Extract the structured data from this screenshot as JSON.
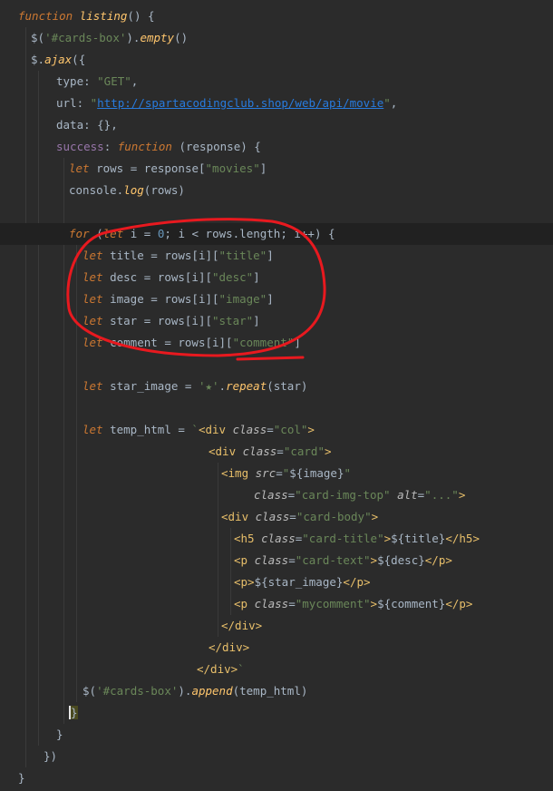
{
  "editor": {
    "lines": [
      [
        [
          "kw",
          "function "
        ],
        [
          "fn",
          "listing"
        ],
        [
          "id",
          "() {"
        ]
      ],
      [
        [
          "id",
          "$("
        ],
        [
          "str",
          "'#cards-box'"
        ],
        [
          "id",
          ")."
        ],
        [
          "fn",
          "empty"
        ],
        [
          "id",
          "()"
        ]
      ],
      [
        [
          "id",
          "$."
        ],
        [
          "fn",
          "ajax"
        ],
        [
          "id",
          "({"
        ]
      ],
      [
        [
          "id",
          "type: "
        ],
        [
          "str",
          "\"GET\""
        ],
        [
          "id",
          ","
        ]
      ],
      [
        [
          "id",
          "url: "
        ],
        [
          "str",
          "\""
        ],
        [
          "url",
          "http://spartacodingclub.shop/web/api/movie"
        ],
        [
          "str",
          "\""
        ],
        [
          "id",
          ","
        ]
      ],
      [
        [
          "id",
          "data: {},"
        ]
      ],
      [
        [
          "prop",
          "success"
        ],
        [
          "id",
          ": "
        ],
        [
          "kw",
          "function "
        ],
        [
          "id",
          "(response) {"
        ]
      ],
      [
        [
          "kw",
          "let "
        ],
        [
          "id",
          "rows = response["
        ],
        [
          "str",
          "\"movies\""
        ],
        [
          "id",
          "]"
        ]
      ],
      [
        [
          "id",
          "console."
        ],
        [
          "fn",
          "log"
        ],
        [
          "id",
          "(rows)"
        ]
      ],
      [
        [
          "id",
          ""
        ]
      ],
      [
        [
          "kw",
          "for "
        ],
        [
          "id",
          "("
        ],
        [
          "kw",
          "let "
        ],
        [
          "id",
          "i = "
        ],
        [
          "num",
          "0"
        ],
        [
          "id",
          "; i < rows.length; i++) {"
        ]
      ],
      [
        [
          "kw",
          "let "
        ],
        [
          "id",
          "title = rows[i]["
        ],
        [
          "str",
          "\"title\""
        ],
        [
          "id",
          "]"
        ]
      ],
      [
        [
          "kw",
          "let "
        ],
        [
          "id",
          "desc = rows[i]["
        ],
        [
          "str",
          "\"desc\""
        ],
        [
          "id",
          "]"
        ]
      ],
      [
        [
          "kw",
          "let "
        ],
        [
          "id",
          "image = rows[i]["
        ],
        [
          "str",
          "\"image\""
        ],
        [
          "id",
          "]"
        ]
      ],
      [
        [
          "kw",
          "let "
        ],
        [
          "id",
          "star = rows[i]["
        ],
        [
          "str",
          "\"star\""
        ],
        [
          "id",
          "]"
        ]
      ],
      [
        [
          "kw",
          "let "
        ],
        [
          "id",
          "comment = rows[i]["
        ],
        [
          "str",
          "\"comment\""
        ],
        [
          "id",
          "]"
        ]
      ],
      [
        [
          "id",
          ""
        ]
      ],
      [
        [
          "kw",
          "let "
        ],
        [
          "id",
          "star_image = "
        ],
        [
          "str",
          "'★'"
        ],
        [
          "id",
          "."
        ],
        [
          "fn",
          "repeat"
        ],
        [
          "id",
          "(star)"
        ]
      ],
      [
        [
          "id",
          ""
        ]
      ],
      [
        [
          "kw",
          "let "
        ],
        [
          "id",
          "temp_html = "
        ],
        [
          "str",
          "`"
        ],
        [
          "tag",
          "<div "
        ],
        [
          "attr",
          "class"
        ],
        [
          "id",
          "="
        ],
        [
          "str",
          "\"col\""
        ],
        [
          "tag",
          ">"
        ]
      ],
      [
        [
          "tag",
          "<div "
        ],
        [
          "attr",
          "class"
        ],
        [
          "id",
          "="
        ],
        [
          "str",
          "\"card\""
        ],
        [
          "tag",
          ">"
        ]
      ],
      [
        [
          "tag",
          "<img "
        ],
        [
          "attr",
          "src"
        ],
        [
          "id",
          "="
        ],
        [
          "str",
          "\""
        ],
        [
          "id",
          "${image}"
        ],
        [
          "str",
          "\""
        ]
      ],
      [
        [
          "attr",
          "class"
        ],
        [
          "id",
          "="
        ],
        [
          "str",
          "\"card-img-top\" "
        ],
        [
          "attr",
          "alt"
        ],
        [
          "id",
          "="
        ],
        [
          "str",
          "\"...\""
        ],
        [
          "tag",
          ">"
        ]
      ],
      [
        [
          "tag",
          "<div "
        ],
        [
          "attr",
          "class"
        ],
        [
          "id",
          "="
        ],
        [
          "str",
          "\"card-body\""
        ],
        [
          "tag",
          ">"
        ]
      ],
      [
        [
          "tag",
          "<h5 "
        ],
        [
          "attr",
          "class"
        ],
        [
          "id",
          "="
        ],
        [
          "str",
          "\"card-title\""
        ],
        [
          "tag",
          ">"
        ],
        [
          "id",
          "${title}"
        ],
        [
          "tag",
          "</h5>"
        ]
      ],
      [
        [
          "tag",
          "<p "
        ],
        [
          "attr",
          "class"
        ],
        [
          "id",
          "="
        ],
        [
          "str",
          "\"card-text\""
        ],
        [
          "tag",
          ">"
        ],
        [
          "id",
          "${desc}"
        ],
        [
          "tag",
          "</p>"
        ]
      ],
      [
        [
          "tag",
          "<p>"
        ],
        [
          "id",
          "${star_image}"
        ],
        [
          "tag",
          "</p>"
        ]
      ],
      [
        [
          "tag",
          "<p "
        ],
        [
          "attr",
          "class"
        ],
        [
          "id",
          "="
        ],
        [
          "str",
          "\"mycomment\""
        ],
        [
          "tag",
          ">"
        ],
        [
          "id",
          "${comment}"
        ],
        [
          "tag",
          "</p>"
        ]
      ],
      [
        [
          "tag",
          "</div>"
        ]
      ],
      [
        [
          "tag",
          "</div>"
        ]
      ],
      [
        [
          "tag",
          "</div>"
        ],
        [
          "str",
          "`"
        ]
      ],
      [
        [
          "id",
          "$("
        ],
        [
          "str",
          "'#cards-box'"
        ],
        [
          "id",
          ")."
        ],
        [
          "fn",
          "append"
        ],
        [
          "id",
          "(temp_html)"
        ]
      ],
      [
        [
          "caret",
          "}"
        ]
      ],
      [
        [
          "id",
          "}"
        ]
      ],
      [
        [
          "id",
          "})"
        ]
      ],
      [
        [
          "id",
          "}"
        ]
      ]
    ]
  }
}
